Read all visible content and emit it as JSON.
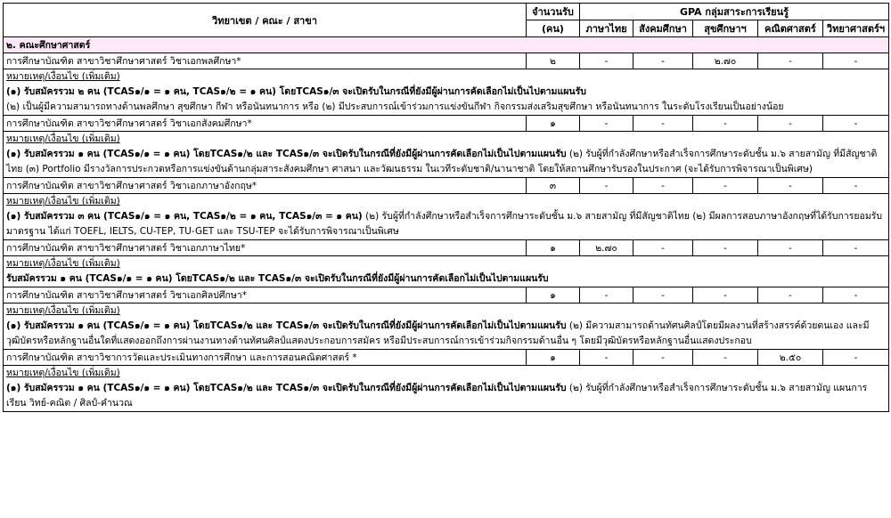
{
  "headers": {
    "program": "วิทยาเขต / คณะ / สาขา",
    "seats": "จำนวนรับ",
    "seats_unit": "(คน)",
    "gpa_group": "GPA กลุ่มสาระการเรียนรู้",
    "subjects": [
      "ภาษาไทย",
      "สังคมศึกษา",
      "สุขศึกษาฯ",
      "คณิตศาสตร์",
      "วิทยาศาสตร์ฯ"
    ]
  },
  "faculty": "๒. คณะศึกษาศาสตร์",
  "programs": [
    {
      "name": "การศึกษาบัณฑิต สาขาวิชาศึกษาศาสตร์ วิชาเอกพลศึกษา*",
      "seats": "๒",
      "gpa": [
        "-",
        "-",
        "๒.๗๐",
        "-",
        "-"
      ],
      "note_label": "หมายเหตุ/เงื่อนไข (เพิ่มเติม)",
      "note_bold": "(๑) รับสมัครรวม ๒ คน (TCAS๑/๑ = ๑ คน, TCAS๑/๒ = ๑ คน) โดยTCAS๑/๓ จะเปิดรับในกรณีที่ยังมีผู้ผ่านการคัดเลือกไม่เป็นไปตามแผนรับ",
      "note_text": "(๒) เป็นผู้มีความสามารถทางด้านพลศึกษา สุขศึกษา กีฬา หรือนันทนาการ หรือ (๒) มีประสบการณ์เข้าร่วมการแข่งขันกีฬา กิจกรรมส่งเสริมสุขศึกษา หรือนันทนาการ ในระดับโรงเรียนเป็นอย่างน้อย"
    },
    {
      "name": "การศึกษาบัณฑิต สาขาวิชาศึกษาศาสตร์ วิชาเอกสังคมศึกษา*",
      "seats": "๑",
      "gpa": [
        "-",
        "-",
        "-",
        "-",
        "-"
      ],
      "note_label": "หมายเหตุ/เงื่อนไข (เพิ่มเติม)",
      "note_bold": "(๑) รับสมัครรวม ๑ คน (TCAS๑/๑ = ๑ คน) โดยTCAS๑/๒ และ TCAS๑/๓ จะเปิดรับในกรณีที่ยังมีผู้ผ่านการคัดเลือกไม่เป็นไปตามแผนรับ",
      "note_text": "(๒) รับผู้ที่กำลังศึกษาหรือสำเร็จการศึกษาระดับชั้น ม.๖ สายสามัญ ที่มีสัญชาติไทย (๓) Portfolio มีรางวัลการประกวดหรือการแข่งขันด้านกลุ่มสาระสังคมศึกษา ศาสนา และวัฒนธรรม ในเวทีระดับชาติ/นานาชาติ โดยให้สถานศึกษารับรองในประกาศ (จะได้รับการพิจารณาเป็นพิเศษ)"
    },
    {
      "name": "การศึกษาบัณฑิต สาขาวิชาศึกษาศาสตร์ วิชาเอกภาษาอังกฤษ*",
      "seats": "๓",
      "gpa": [
        "-",
        "-",
        "-",
        "-",
        "-"
      ],
      "note_label": "หมายเหตุ/เงื่อนไข (เพิ่มเติม)",
      "note_bold": "(๑) รับสมัครรวม ๓ คน (TCAS๑/๑ = ๑ คน, TCAS๑/๒ = ๑ คน, TCAS๑/๓ = ๑ คน)",
      "note_text": "(๒) รับผู้ที่กำลังศึกษาหรือสำเร็จการศึกษาระดับชั้น ม.๖ สายสามัญ ที่มีสัญชาติไทย (๒) มีผลการสอบภาษาอังกฤษที่ได้รับการยอมรับมาตรฐาน ได้แก่ TOEFL, IELTS, CU-TEP, TU-GET และ TSU-TEP จะได้รับการพิจารณาเป็นพิเศษ"
    },
    {
      "name": "การศึกษาบัณฑิต สาขาวิชาศึกษาศาสตร์ วิชาเอกภาษาไทย*",
      "seats": "๑",
      "gpa": [
        "๒.๗๐",
        "-",
        "-",
        "-",
        "-"
      ],
      "note_label": "หมายเหตุ/เงื่อนไข (เพิ่มเติม)",
      "note_bold": "รับสมัครรวม ๑ คน (TCAS๑/๑ = ๑ คน) โดยTCAS๑/๒ และ TCAS๑/๓ จะเปิดรับในกรณีที่ยังมีผู้ผ่านการคัดเลือกไม่เป็นไปตามแผนรับ",
      "note_text": ""
    },
    {
      "name": "การศึกษาบัณฑิต สาขาวิชาศึกษาศาสตร์ วิชาเอกศิลปศึกษา*",
      "seats": "๑",
      "gpa": [
        "-",
        "-",
        "-",
        "-",
        "-"
      ],
      "note_label": "หมายเหตุ/เงื่อนไข (เพิ่มเติม)",
      "note_bold": "(๑) รับสมัครรวม ๑ คน (TCAS๑/๑ = ๑ คน) โดยTCAS๑/๒ และ TCAS๑/๓ จะเปิดรับในกรณีที่ยังมีผู้ผ่านการคัดเลือกไม่เป็นไปตามแผนรับ",
      "note_text": "(๒) มีความสามารถด้านทัศนศิลป์โดยมีผลงานที่สร้างสรรค์ด้วยตนเอง และมีวุฒิบัตรหรือหลักฐานอื่นใดที่แสดงออกถึงการผ่านงานทางด้านทัศนศิลป์แสดงประกอบการสมัคร หรือมีประสบการณ์การเข้าร่วมกิจกรรมด้านอื่น ๆ โดยมีวุฒิบัตรหรือหลักฐานอื่นแสดงประกอบ"
    },
    {
      "name": "การศึกษาบัณฑิต สาขาวิชาการวัดและประเมินทางการศึกษา และการสอนคณิตศาสตร์ *",
      "seats": "๑",
      "gpa": [
        "-",
        "-",
        "-",
        "๒.๕๐",
        "-"
      ],
      "note_label": "หมายเหตุ/เงื่อนไข (เพิ่มเติม)",
      "note_bold": "(๑) รับสมัครรวม ๑ คน (TCAS๑/๑ = ๑ คน) โดยTCAS๑/๒ และ TCAS๑/๓ จะเปิดรับในกรณีที่ยังมีผู้ผ่านการคัดเลือกไม่เป็นไปตามแผนรับ",
      "note_text": "(๒) รับผู้ที่กำลังศึกษาหรือสำเร็จการศึกษาระดับชั้น ม.๖ สายสามัญ แผนการเรียน วิทย์-คณิต / ศิลป์-คำนวณ"
    }
  ]
}
